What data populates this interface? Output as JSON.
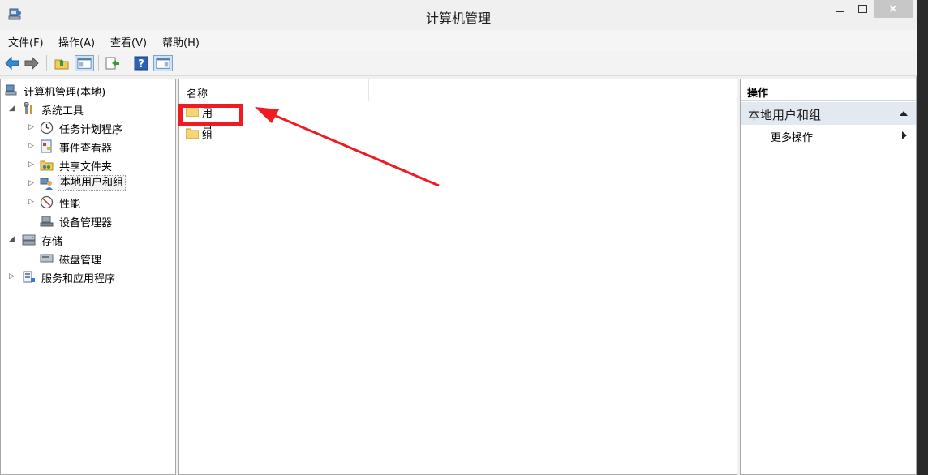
{
  "window": {
    "title": "计算机管理"
  },
  "title_buttons": {
    "close_glyph": "✕"
  },
  "menu": {
    "items": [
      "文件(F)",
      "操作(A)",
      "查看(V)",
      "帮助(H)"
    ]
  },
  "toolbar": {
    "icons": [
      "back-arrow-icon",
      "forward-arrow-icon",
      "up-folder-icon",
      "show-hide-console-tree-icon",
      "export-list-icon",
      "help-icon",
      "show-hide-action-pane-icon"
    ]
  },
  "tree": {
    "root": "计算机管理(本地)",
    "system_tools": "系统工具",
    "task_scheduler": "任务计划程序",
    "event_viewer": "事件查看器",
    "shared_folders": "共享文件夹",
    "local_users_groups": "本地用户和组",
    "performance": "性能",
    "device_manager": "设备管理器",
    "storage": "存储",
    "disk_management": "磁盘管理",
    "services_apps": "服务和应用程序"
  },
  "list": {
    "column_name": "名称",
    "items": [
      "用户",
      "组"
    ]
  },
  "actions": {
    "header": "操作",
    "section": "本地用户和组",
    "more": "更多操作"
  },
  "colors": {
    "annotation_red": "#ee1b23",
    "selection_blue": "#e2e9f1"
  }
}
